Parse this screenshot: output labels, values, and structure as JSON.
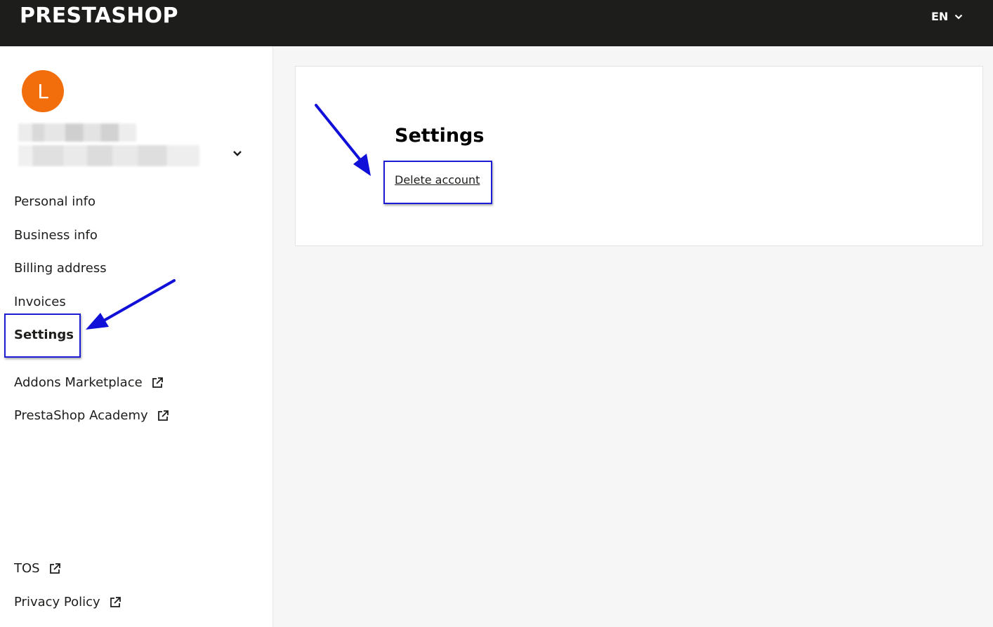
{
  "header": {
    "logo": "PRESTASHOP",
    "language": "EN"
  },
  "account": {
    "avatar_initial": "L"
  },
  "sidebar": {
    "items": [
      {
        "label": "Personal info"
      },
      {
        "label": "Business info"
      },
      {
        "label": "Billing address"
      },
      {
        "label": "Invoices"
      },
      {
        "label": "Settings",
        "active": true
      }
    ],
    "external_links": [
      {
        "label": "Addons Marketplace",
        "icon": "external-link-icon"
      },
      {
        "label": "PrestaShop Academy",
        "icon": "external-link-icon"
      }
    ],
    "footer_links": [
      {
        "label": "TOS",
        "icon": "external-link-icon"
      },
      {
        "label": "Privacy Policy",
        "icon": "external-link-icon"
      }
    ]
  },
  "main": {
    "title": "Settings",
    "delete_account_label": "Delete account"
  },
  "colors": {
    "header_bg": "#1d1d1b",
    "avatar_bg": "#f26e0d",
    "annotation": "#1c1cd0",
    "page_bg": "#f6f6f6"
  }
}
